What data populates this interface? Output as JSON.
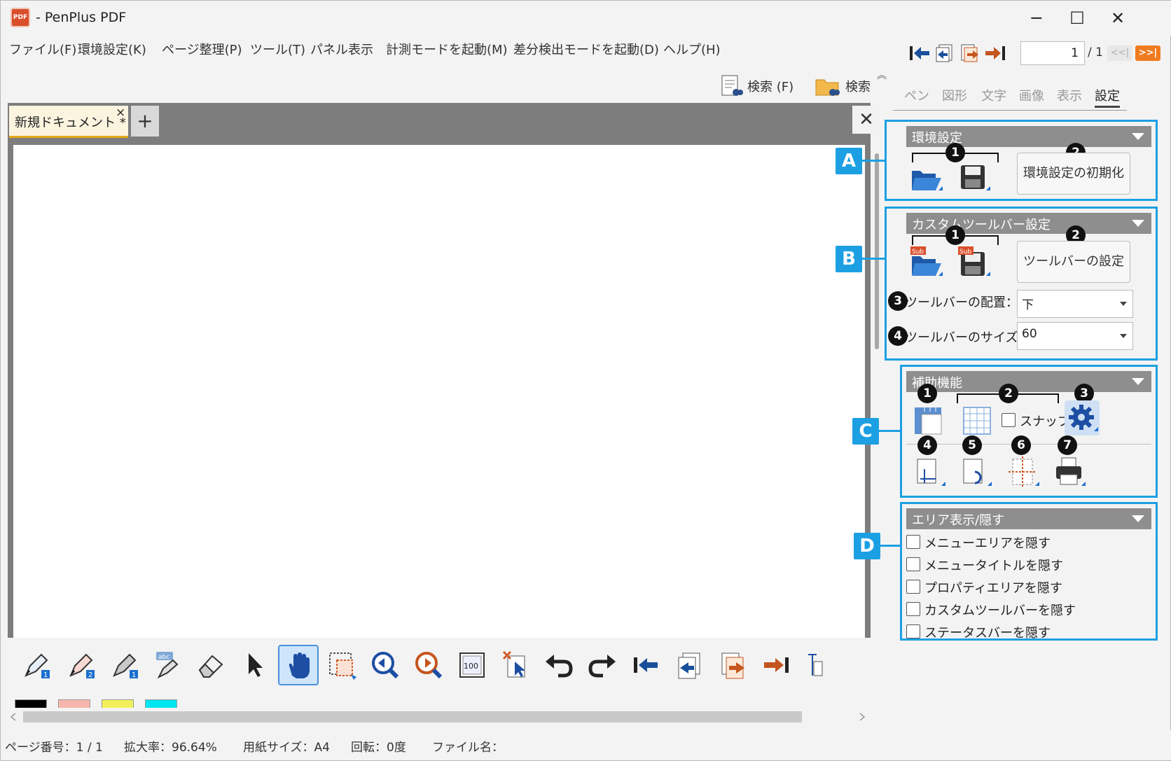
{
  "window": {
    "app_icon_text": "PDF",
    "title": "- PenPlus PDF",
    "minimize": "─",
    "maximize": "☐",
    "close": "✕"
  },
  "menu": [
    "ファイル(F)",
    "環境設定(K)",
    "ページ整理(P)",
    "ツール(T)",
    "パネル表示",
    "計測モードを起動(M)",
    "差分検出モードを起動(D)",
    "ヘルプ(H)"
  ],
  "page_nav": {
    "current_page": "1",
    "total": "/ 1",
    "fast_back": "<<|",
    "fast_forward": ">>|"
  },
  "search": {
    "search_text": "検索 (F)",
    "search_folder": "検索"
  },
  "tabs": {
    "doc_tab": "新規ドキュメント *",
    "tab_close": "×",
    "add": "+",
    "strip_close": "✕"
  },
  "right_panel": {
    "tabs": [
      "ペン",
      "図形",
      "文字",
      "画像",
      "表示",
      "設定"
    ],
    "active_tab": "設定"
  },
  "sections": {
    "a": {
      "tag": "A",
      "header": "環境設定",
      "num1": "1",
      "num2": "2",
      "reset_button": "環境設定の初期化"
    },
    "b": {
      "tag": "B",
      "header": "カスタムツールバー設定",
      "num1": "1",
      "num2": "2",
      "num3": "3",
      "num4": "4",
      "sub_badge": "Sub",
      "toolbar_settings_button": "ツールバーの設定",
      "placement_label": "ツールバーの配置：",
      "placement_value": "下",
      "size_label": "ツールバーのサイズ：",
      "size_value": "60"
    },
    "c": {
      "tag": "C",
      "header": "補助機能",
      "nums": [
        "1",
        "2",
        "3",
        "4",
        "5",
        "6",
        "7"
      ],
      "snap_label": "スナップ"
    },
    "d": {
      "tag": "D",
      "header": "エリア表示/隠す",
      "checkboxes": [
        "メニューエリアを隠す",
        "メニュータイトルを隠す",
        "プロパティエリアを隠す",
        "カスタムツールバーを隠す",
        "ステータスバーを隠す"
      ]
    }
  },
  "toolbar": {
    "zoom_100": "100",
    "swatches": [
      "#000000",
      "#f7b5ac",
      "#f2f05a",
      "#00e5f0"
    ]
  },
  "status": {
    "page": "ページ番号：1 / 1",
    "zoom": "拡大率：96.64%",
    "paper": "用紙サイズ：A4",
    "rotation": "回転：0度",
    "filename": "ファイル名："
  },
  "colors": {
    "accent": "#1ca0e3",
    "section_header": "#8e8e8e",
    "canvas_bg": "#7d7d7d",
    "tab_highlight": "#e6a817"
  }
}
